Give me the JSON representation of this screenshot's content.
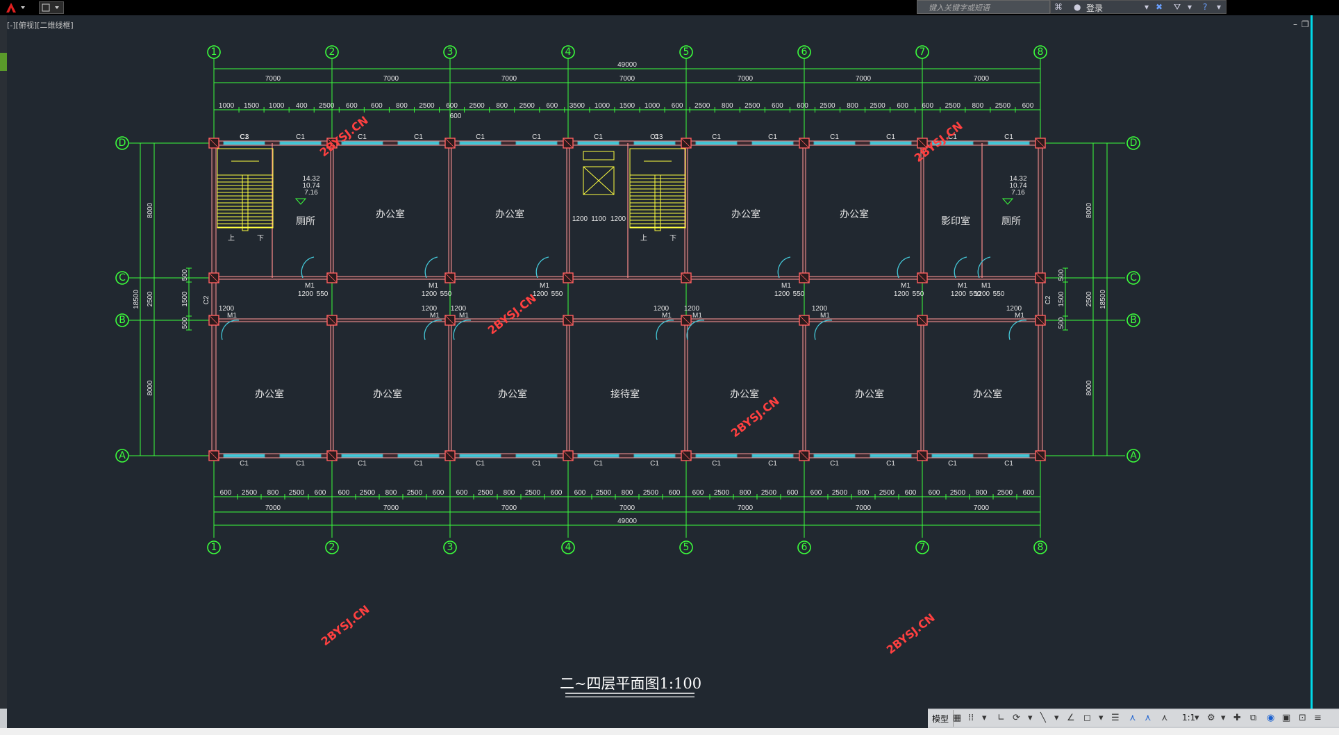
{
  "app": {
    "search_placeholder": "键入关键字或短语",
    "login_label": "登录",
    "viewport_label": "[-][俯视][二维线框]",
    "status_model_tab": "模型",
    "status_scale": "1:1"
  },
  "drawing": {
    "title": "二~四层平面图1:100",
    "axis_x_labels": [
      "1",
      "2",
      "3",
      "4",
      "5",
      "6",
      "7",
      "8"
    ],
    "axis_y_labels": [
      "D",
      "C",
      "B",
      "A"
    ],
    "total_width_label": "49000",
    "bay_width_label": "7000",
    "top_segments": [
      "1000",
      "1500",
      "1000",
      "400",
      "2500",
      "600",
      "600",
      "800",
      "2500",
      "600",
      "2500",
      "800",
      "2500",
      "600",
      "3500",
      "1000",
      "1500",
      "1000",
      "600",
      "2500",
      "800",
      "2500",
      "600",
      "600",
      "2500",
      "800",
      "2500",
      "600",
      "600",
      "2500",
      "800",
      "2500",
      "600"
    ],
    "bottom_segments": [
      "600",
      "2500",
      "800",
      "2500",
      "600",
      "600",
      "2500",
      "800",
      "2500",
      "600",
      "600",
      "2500",
      "800",
      "2500",
      "600",
      "600",
      "2500",
      "800",
      "2500",
      "600",
      "600",
      "2500",
      "800",
      "2500",
      "600",
      "600",
      "2500",
      "800",
      "2500",
      "600",
      "600",
      "2500",
      "800",
      "2500",
      "600"
    ],
    "side_dims": {
      "span_d_c": "8000",
      "span_c_b": "2500",
      "span_b_a": "8000",
      "total_depth": "18500",
      "left_small_1": "500",
      "left_small_2": "1500",
      "left_small_3": "500",
      "right_small_1": "500",
      "right_small_2": "1500",
      "right_small_3": "500",
      "top_600": "600",
      "window_c2": "C2"
    },
    "rooms_north": [
      "厕所",
      "办公室",
      "办公室",
      "办公室",
      "办公室",
      "影印室",
      "厕所"
    ],
    "rooms_south": [
      "办公室",
      "办公室",
      "办公室",
      "接待室",
      "办公室",
      "办公室",
      "办公室"
    ],
    "stair_up": "上",
    "stair_down": "下",
    "elevation_marks": [
      "14.32",
      "10.74",
      "7.16"
    ],
    "window_c1": "C1",
    "window_c3": "C3",
    "door_m1": "M1",
    "corridor_dims": [
      "1200",
      "550",
      "1100",
      "500",
      "1500"
    ],
    "watermark": "2BYSJ.CN"
  }
}
